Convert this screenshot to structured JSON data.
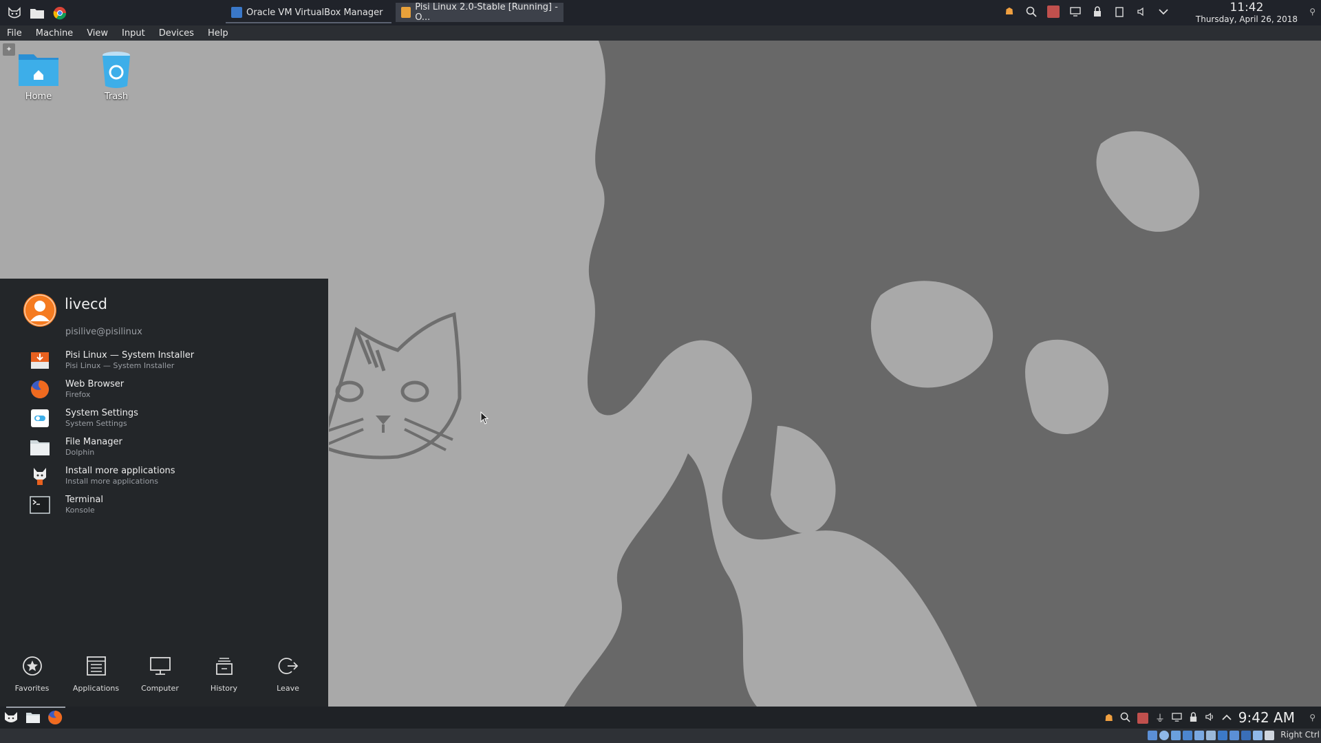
{
  "host_panel": {
    "tasks": [
      {
        "label": "Oracle VM VirtualBox Manager"
      },
      {
        "label": "Pisi Linux 2.0-Stable [Running] - O..."
      }
    ],
    "clock": {
      "time": "11:42",
      "date": "Thursday, April 26, 2018"
    }
  },
  "vbox_menu": [
    "File",
    "Machine",
    "View",
    "Input",
    "Devices",
    "Help"
  ],
  "desktop": {
    "icons": [
      {
        "label": "Home",
        "icon": "home-folder-icon"
      },
      {
        "label": "Trash",
        "icon": "trash-icon"
      }
    ]
  },
  "launcher": {
    "user": {
      "name": "livecd",
      "host": "pisilive@pisilinux"
    },
    "favorites": [
      {
        "title": "Pisi Linux — System Installer",
        "subtitle": "Pisi Linux — System Installer",
        "icon": "installer-icon"
      },
      {
        "title": "Web Browser",
        "subtitle": "Firefox",
        "icon": "firefox-icon"
      },
      {
        "title": "System Settings",
        "subtitle": "System Settings",
        "icon": "settings-toggle-icon"
      },
      {
        "title": "File Manager",
        "subtitle": "Dolphin",
        "icon": "folder-icon"
      },
      {
        "title": "Install more applications",
        "subtitle": "Install more applications",
        "icon": "cat-app-icon"
      },
      {
        "title": "Terminal",
        "subtitle": "Konsole",
        "icon": "terminal-icon"
      }
    ],
    "tabs": [
      "Favorites",
      "Applications",
      "Computer",
      "History",
      "Leave"
    ]
  },
  "guest_panel": {
    "clock": "9:42 AM"
  },
  "vbox_status": {
    "host_key": "Right Ctrl"
  },
  "colors": {
    "accent_orange": "#f57b20",
    "panel_dark": "#232629",
    "wallpaper_light": "#a9a9a9",
    "wallpaper_dark": "#686868"
  }
}
